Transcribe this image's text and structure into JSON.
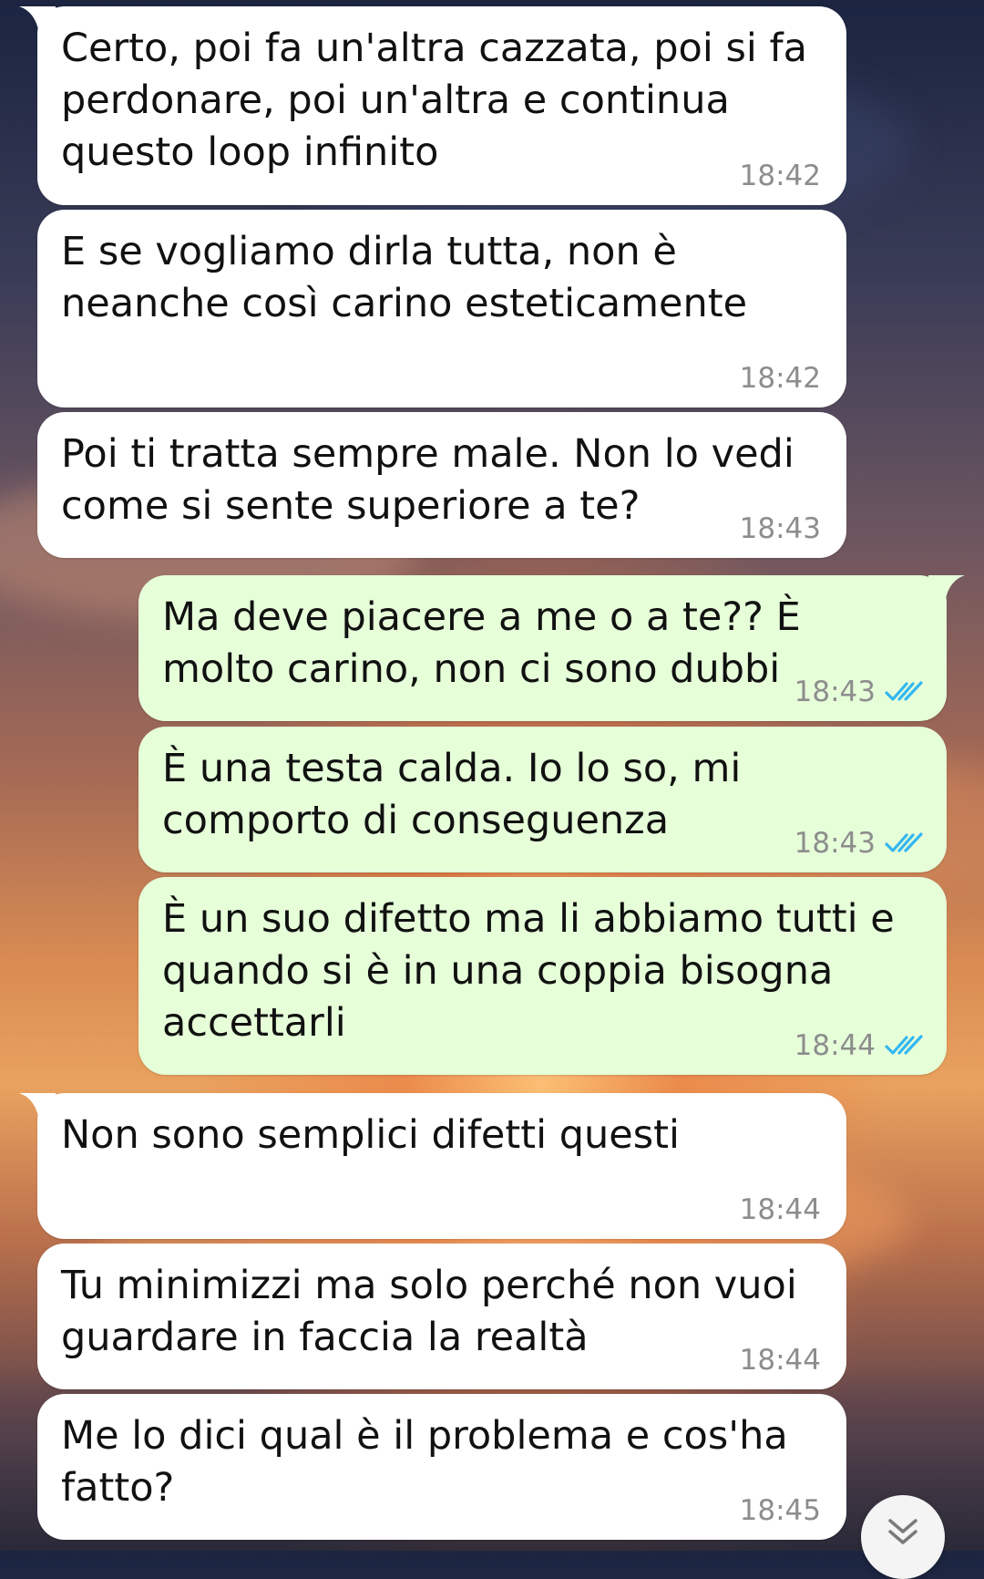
{
  "messages": [
    {
      "dir": "in",
      "text": "Certo, poi fa un'altra cazzata, poi si fa perdonare, poi un'altra e continua questo loop infinito",
      "time": "18:42"
    },
    {
      "dir": "in",
      "text": "E se vogliamo dirla tutta, non è neanche così carino esteticamente",
      "time": "18:42"
    },
    {
      "dir": "in",
      "text": "Poi ti tratta sempre male. Non lo vedi come si sente superiore a te?",
      "time": "18:43"
    },
    {
      "dir": "out",
      "text": "Ma deve piacere a me o a te?? È molto carino, non ci sono dubbi",
      "time": "18:43",
      "status": "read"
    },
    {
      "dir": "out",
      "text": "È una testa calda. Io lo so, mi comporto di conseguenza",
      "time": "18:43",
      "status": "read"
    },
    {
      "dir": "out",
      "text": "È un suo difetto ma li abbiamo tutti e quando si è in una coppia bisogna accettarli",
      "time": "18:44",
      "status": "read"
    },
    {
      "dir": "in",
      "text": "Non sono semplici difetti questi",
      "time": "18:44"
    },
    {
      "dir": "in",
      "text": "Tu minimizzi ma solo perché non vuoi guardare in faccia la realtà",
      "time": "18:44"
    },
    {
      "dir": "in",
      "text": "Me lo dici qual è il problema e cos'ha fatto?",
      "time": "18:45"
    }
  ],
  "colors": {
    "incoming_bubble": "#ffffff",
    "outgoing_bubble": "#e6ffd9",
    "timestamp": "#8d8d8d",
    "read_ticks": "#34b7f1"
  },
  "icons": {
    "read_receipt": "double-check-icon",
    "scroll_down": "chevron-double-down-icon"
  }
}
